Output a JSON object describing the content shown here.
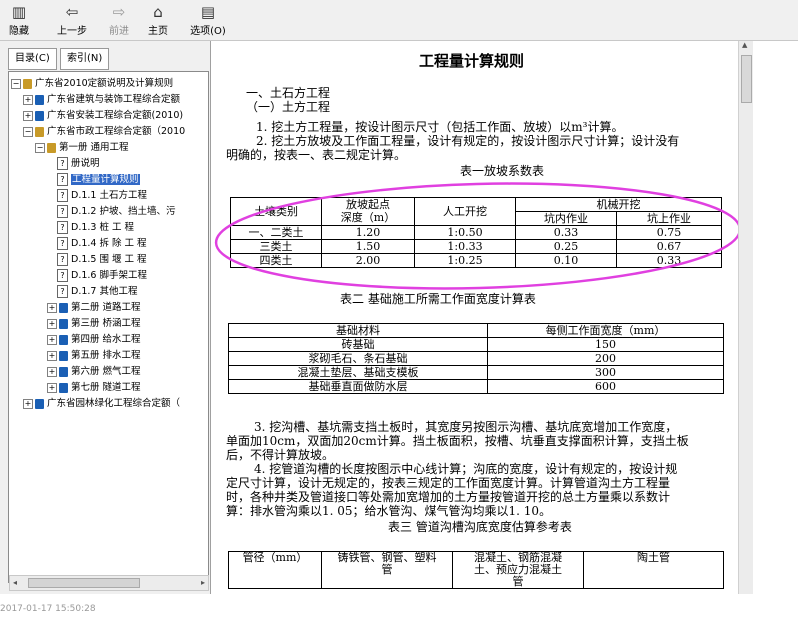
{
  "toolbar": {
    "hide": "隐藏",
    "back": "上一步",
    "forward": "前进",
    "home": "主页",
    "options": "选项(O)"
  },
  "left_panel": {
    "tab_contents": "目录(C)",
    "tab_index": "索引(N)",
    "tree": [
      "广东省2010定额说明及计算规则",
      "广东省建筑与装饰工程综合定额",
      "广东省安装工程综合定额(2010)",
      "广东省市政工程综合定额（2010",
      "第一册 通用工程",
      "册说明",
      "工程量计算规则",
      "D.1.1 土石方工程",
      "D.1.2 护坡、挡土墙、污",
      "D.1.3 桩 工 程",
      "D.1.4 拆 除 工 程",
      "D.1.5 围 堰 工 程",
      "D.1.6 脚手架工程",
      "D.1.7 其他工程",
      "第二册 道路工程",
      "第三册 桥涵工程",
      "第四册 给水工程",
      "第五册 排水工程",
      "第六册 燃气工程",
      "第七册 隧道工程",
      "广东省园林绿化工程综合定额（"
    ]
  },
  "document": {
    "title": "工程量计算规则",
    "h1": "一、土石方工程",
    "h2": "（一）土方工程",
    "p1": "1. 挖土方工程量，按设计图示尺寸（包括工作面、放坡）以m³计算。",
    "p2a": "2. 挖土方放坡及工作面工程量，设计有规定的，按设计图示尺寸计算；设计没有",
    "p2b": "明确的，按表一、表二规定计算。",
    "table1_caption": "表一放坡系数表",
    "table1": {
      "h_soil": "土壤类别",
      "h_start_a": "放坡起点",
      "h_start_b": "深度（m）",
      "h_manual": "人工开挖",
      "h_mech": "机械开挖",
      "h_in_pit": "坑内作业",
      "h_on_pit": "坑上作业",
      "rows": [
        [
          "一、二类土",
          "1.20",
          "1:0.50",
          "0.33",
          "0.75"
        ],
        [
          "三类土",
          "1.50",
          "1:0.33",
          "0.25",
          "0.67"
        ],
        [
          "四类土",
          "2.00",
          "1:0.25",
          "0.10",
          "0.33"
        ]
      ]
    },
    "table2_caption": "表二  基础施工所需工作面宽度计算表",
    "table2": {
      "h_material": "基础材料",
      "h_width": "每侧工作面宽度（mm）",
      "rows": [
        [
          "砖基础",
          "150"
        ],
        [
          "浆砌毛石、条石基础",
          "200"
        ],
        [
          "混凝土垫层、基础支模板",
          "300"
        ],
        [
          "基础垂直面做防水层",
          "600"
        ]
      ]
    },
    "p3a": "3. 挖沟槽、基坑需支挡土板时，其宽度另按图示沟槽、基坑底宽增加工作宽度，",
    "p3b": "单面加10cm，双面加20cm计算。挡土板面积，按槽、坑垂直支撑面积计算，支挡土板",
    "p3c": "后，不得计算放坡。",
    "p4a": "4. 挖管道沟槽的长度按图示中心线计算；沟底的宽度，设计有规定的，按设计规",
    "p4b": "定尺寸计算，设计无规定的，按表三规定的工作面宽度计算。计算管道沟土方工程量",
    "p4c": "时，各种井类及管道接口等处需加宽增加的土方量按管道开挖的总土方量乘以系数计",
    "p4d": "算：排水管沟乘以1. 05；给水管沟、煤气管沟均乘以1. 10。",
    "table3_caption": "表三  管道沟槽沟底宽度估算参考表",
    "table3": {
      "h_dia": "管径（mm）",
      "h_iron_a": "铸铁管、钢管、塑料",
      "h_iron_b": "管",
      "h_conc_a": "混凝土、钢筋混凝",
      "h_conc_b": "土、预应力混凝土",
      "h_conc_c": "管",
      "h_clay": "陶土管"
    }
  },
  "status": {
    "timestamp": "2017-01-17 15:50:28"
  },
  "colors": {
    "annotation": "#e040e0",
    "selection": "#3168c6"
  }
}
